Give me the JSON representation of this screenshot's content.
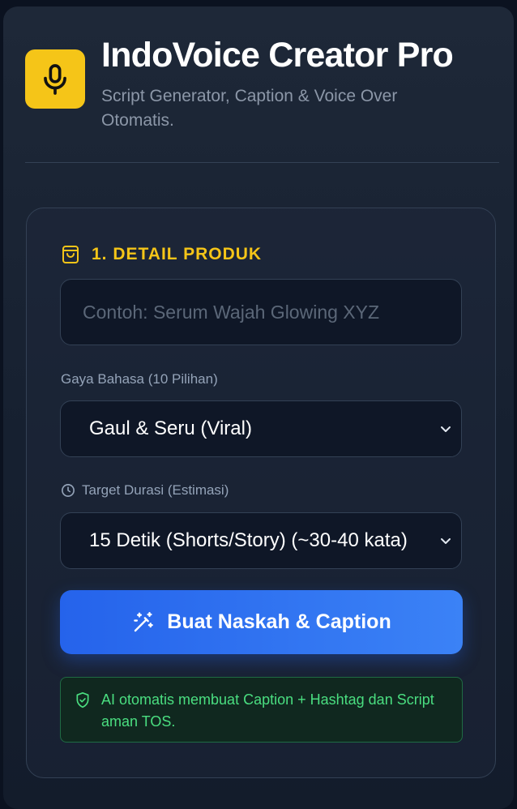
{
  "header": {
    "title": "IndoVoice Creator Pro",
    "subtitle": "Script Generator, Caption & Voice Over Otomatis.",
    "logo_icon": "microphone-icon"
  },
  "colors": {
    "accent_yellow": "#f5c518",
    "primary_blue": "#2563eb",
    "success_green": "#4ade80"
  },
  "form": {
    "section_title": "1. DETAIL PRODUK",
    "section_icon": "shopping-bag-icon",
    "product_input": {
      "value": "",
      "placeholder": "Contoh: Serum Wajah Glowing XYZ"
    },
    "style_label": "Gaya Bahasa (10 Pilihan)",
    "style_selected": "Gaul & Seru (Viral)",
    "duration_label": "Target Durasi (Estimasi)",
    "duration_selected": "15 Detik (Shorts/Story) (~30-40 kata)",
    "generate_button": "Buat Naskah & Caption",
    "info_text": "AI otomatis membuat Caption + Hashtag dan Script aman TOS."
  }
}
